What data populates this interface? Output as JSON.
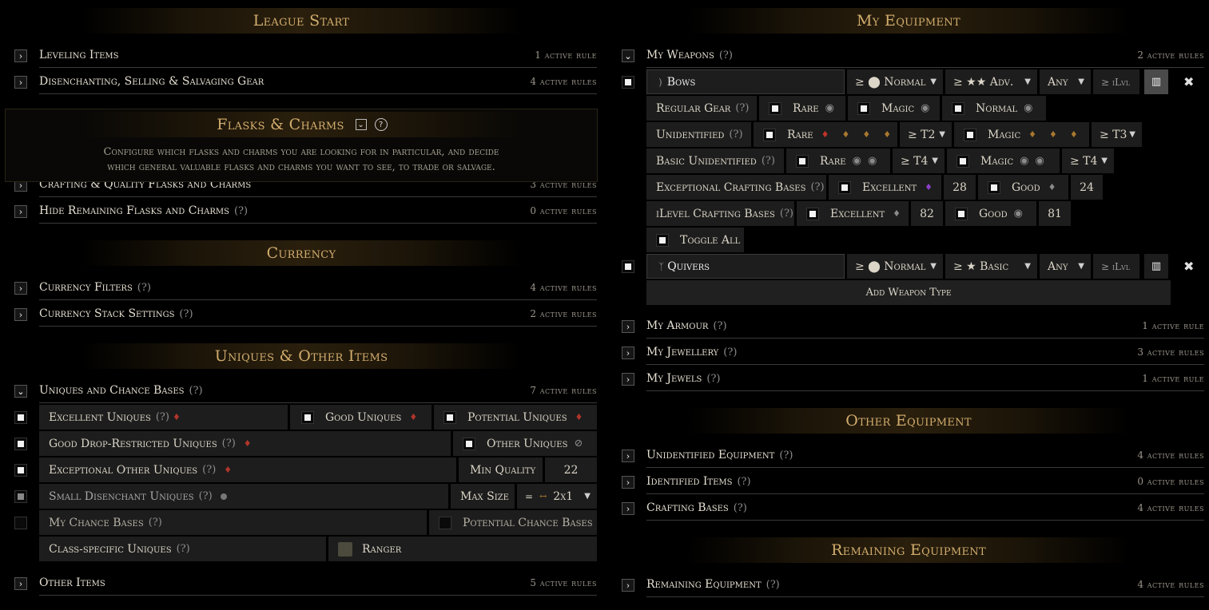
{
  "left": {
    "league_start": {
      "title": "League Start",
      "rows": [
        {
          "label": "Leveling Items",
          "count": "1 active rule"
        },
        {
          "label": "Disenchanting, Selling & Salvaging Gear",
          "count": "4 active rules"
        }
      ]
    },
    "flasks": {
      "title": "Flasks & Charms",
      "description_line1": "Configure which flasks and charms you are looking for in particular, and decide",
      "description_line2": "which general valuable flasks and charms you want to see, to trade or salvage.",
      "rows": [
        {
          "label": "Crafting & Quality Flasks and Charms",
          "count": "3 active rules"
        },
        {
          "label": "Hide Remaining Flasks and Charms",
          "q": "(?)",
          "count": "0 active rules"
        }
      ]
    },
    "currency": {
      "title": "Currency",
      "rows": [
        {
          "label": "Currency Filters",
          "q": "(?)",
          "count": "4 active rules"
        },
        {
          "label": "Currency Stack Settings",
          "q": "(?)",
          "count": "2 active rules"
        }
      ]
    },
    "uniques": {
      "title": "Uniques & Other Items",
      "main": {
        "label": "Uniques and Chance Bases",
        "q": "(?)",
        "count": "7 active rules"
      },
      "excellent": {
        "label": "Excellent Uniques",
        "q": "(?)"
      },
      "good_uniques": "Good Uniques",
      "potential_uniques": "Potential Uniques",
      "good_drop": {
        "label": "Good Drop-Restricted Uniques",
        "q": "(?)"
      },
      "other_uniques": "Other Uniques",
      "exceptional": {
        "label": "Exceptional Other Uniques",
        "q": "(?)"
      },
      "min_quality_label": "Min Quality",
      "min_quality_value": "22",
      "small_dis": {
        "label": "Small Disenchant Uniques",
        "q": "(?)"
      },
      "max_size_label": "Max Size",
      "max_size_value": "2x1",
      "max_size_eq": "=",
      "chance": {
        "label": "My Chance Bases",
        "q": "(?)"
      },
      "potential_chance": "Potential Chance Bases",
      "class_specific": {
        "label": "Class-specific Uniques",
        "q": "(?)"
      },
      "class_value": "Ranger",
      "other_items": {
        "label": "Other Items",
        "count": "5 active rules"
      }
    }
  },
  "right": {
    "my_equipment": {
      "title": "My Equipment",
      "weapons": {
        "label": "My Weapons",
        "q": "(?)",
        "count": "2 active rules"
      },
      "bows": {
        "name": "Bows",
        "rarity": "≥ ⬤ Normal",
        "tier": "≥ ★★ Adv.",
        "any": "Any",
        "ilvl": "≥ iLvl",
        "regular_gear": {
          "label": "Regular Gear",
          "q": "(?)",
          "opts": [
            "Rare",
            "Magic",
            "Normal"
          ]
        },
        "unidentified": {
          "label": "Unidentified",
          "q": "(?)",
          "rare": "Rare",
          "t1": "≥ T2",
          "magic": "Magic",
          "t2": "≥ T3"
        },
        "basic_unid": {
          "label": "Basic Unidentified",
          "q": "(?)",
          "rare": "Rare",
          "t1": "≥ T4",
          "magic": "Magic",
          "t2": "≥ T4"
        },
        "exceptional": {
          "label": "Exceptional Crafting Bases",
          "q": "(?)",
          "excellent": "Excellent",
          "v1": "28",
          "good": "Good",
          "v2": "24"
        },
        "ilevel": {
          "label": "iLevel Crafting Bases",
          "q": "(?)",
          "excellent": "Excellent",
          "v1": "82",
          "good": "Good",
          "v2": "81"
        },
        "toggle_all": "Toggle All"
      },
      "quivers": {
        "name": "Quivers",
        "rarity": "≥ ⬤ Normal",
        "tier": "≥ ★ Basic",
        "any": "Any",
        "ilvl": "≥ iLvl"
      },
      "add_weapon": "Add Weapon Type",
      "rows": [
        {
          "label": "My Armour",
          "q": "(?)",
          "count": "1 active rule"
        },
        {
          "label": "My Jewellery",
          "q": "(?)",
          "count": "3 active rules"
        },
        {
          "label": "My Jewels",
          "q": "(?)",
          "count": "1 active rule"
        }
      ]
    },
    "other_equipment": {
      "title": "Other Equipment",
      "rows": [
        {
          "label": "Unidentified Equipment",
          "q": "(?)",
          "count": "4 active rules"
        },
        {
          "label": "Identified Items",
          "q": "(?)",
          "count": "0 active rules"
        },
        {
          "label": "Crafting Bases",
          "q": "(?)",
          "count": "4 active rules"
        }
      ]
    },
    "remaining_equipment": {
      "title": "Remaining Equipment",
      "rows": [
        {
          "label": "Remaining Equipment",
          "q": "(?)",
          "count": "4 active rules"
        }
      ]
    }
  },
  "colors": {
    "accent_gold": "#d2ad6e",
    "background": "#000000",
    "panel": "#1d1d1d",
    "red_gem": "#b0352a",
    "purple_gem": "#8a3fc8",
    "orange_gem": "#a9782f"
  }
}
